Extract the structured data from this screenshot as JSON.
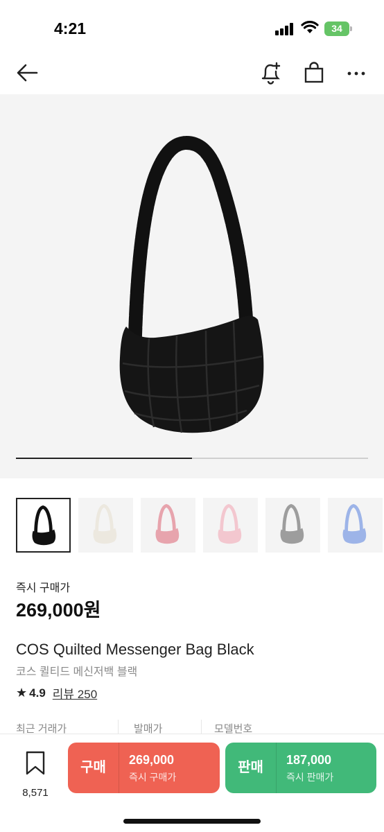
{
  "status_bar": {
    "time": "4:21",
    "battery": "34"
  },
  "nav": {
    "back_icon": "arrow-left-icon",
    "alert_icon": "bell-plus-icon",
    "bag_icon": "shopping-bag-icon",
    "more_icon": "more-horizontal-icon"
  },
  "hero": {
    "slide_progress": 0.5
  },
  "thumbnails": [
    {
      "color": "#111111",
      "selected": true
    },
    {
      "color": "#ece8df",
      "selected": false
    },
    {
      "color": "#e7a4ad",
      "selected": false
    },
    {
      "color": "#f3c7cf",
      "selected": false
    },
    {
      "color": "#9d9d9d",
      "selected": false
    },
    {
      "color": "#9db4e8",
      "selected": false
    }
  ],
  "product": {
    "price_label": "즉시 구매가",
    "price": "269,000원",
    "name": "COS Quilted Messenger Bag Black",
    "name_ko": "코스 퀼티드 메신저백 블랙",
    "rating": "4.9",
    "review": "리뷰 250"
  },
  "info": {
    "recent_price_label": "최근 거래가",
    "release_price_label": "발매가",
    "model_number_label": "모델번호"
  },
  "bottom": {
    "wish_count": "8,571",
    "buy": {
      "label": "구매",
      "price": "269,000",
      "sub": "즉시 구매가",
      "color": "#ef6253"
    },
    "sell": {
      "label": "판매",
      "price": "187,000",
      "sub": "즉시 판매가",
      "color": "#41b979"
    }
  }
}
